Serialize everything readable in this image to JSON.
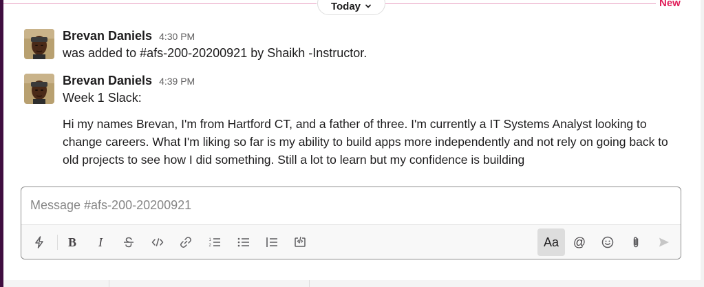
{
  "divider": {
    "today_label": "Today",
    "new_label": "New"
  },
  "messages": [
    {
      "author": "Brevan Daniels",
      "time": "4:30 PM",
      "text": "was added to #afs-200-20200921 by Shaikh -Instructor."
    },
    {
      "author": "Brevan Daniels",
      "time": "4:39 PM",
      "text": "Week 1 Slack:",
      "paragraph": "Hi my names Brevan, I'm from Hartford CT, and a father of three. I'm currently a IT Systems Analyst looking to change careers. What I'm liking so far is my ability to build apps more independently and not rely on going back to old projects to see how I did something. Still a lot to learn but my confidence is building"
    }
  ],
  "composer": {
    "placeholder": "Message #afs-200-20200921",
    "value": "",
    "toolbar": {
      "bold_label": "B",
      "italic_label": "I",
      "format_label": "Aa",
      "mention_label": "@"
    }
  },
  "colors": {
    "new_divider": "#e8a2c4",
    "new_label": "#e01e5a",
    "sidebar": "#3f0e40"
  }
}
